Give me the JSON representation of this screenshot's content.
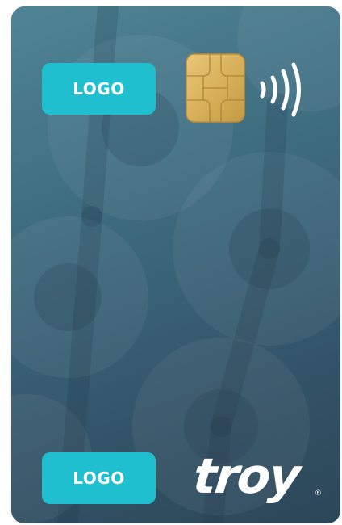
{
  "card": {
    "logo_top_label": "LOGO",
    "logo_bottom_label": "LOGO",
    "brand_name": "troy",
    "brand_registered_mark": "®"
  },
  "icons": {
    "chip": "emv-chip-icon",
    "contactless": "contactless-icon"
  },
  "colors": {
    "card_gradient_start": "#4f8496",
    "card_gradient_end": "#2c4658",
    "logo_button": "#1fbfcf",
    "chip_gold": "#d9b15c",
    "text": "#ffffff"
  }
}
